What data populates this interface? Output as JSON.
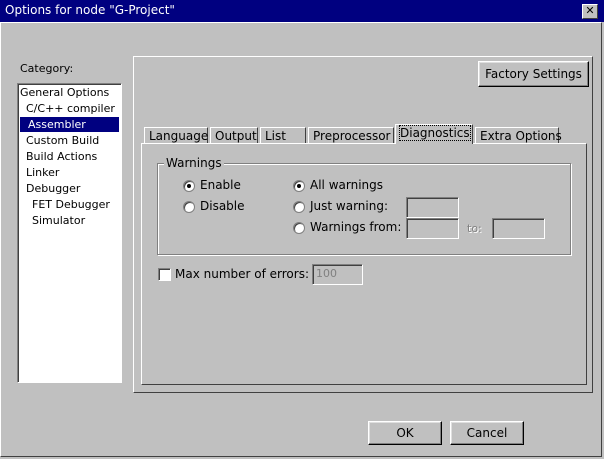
{
  "window": {
    "title": "Options for node \"G-Project\"",
    "close_glyph": "✕"
  },
  "category": {
    "label": "Category:",
    "items": [
      {
        "label": "General Options"
      },
      {
        "label": "C/C++ compiler"
      },
      {
        "label": "Assembler"
      },
      {
        "label": "Custom Build"
      },
      {
        "label": "Build Actions"
      },
      {
        "label": "Linker"
      },
      {
        "label": "Debugger"
      },
      {
        "label": "FET Debugger"
      },
      {
        "label": "Simulator"
      }
    ],
    "selected": "Assembler"
  },
  "factory_settings_label": "Factory Settings",
  "tabs": [
    {
      "label": "Language"
    },
    {
      "label": "Output"
    },
    {
      "label": "List"
    },
    {
      "label": "Preprocessor"
    },
    {
      "label": "Diagnostics"
    },
    {
      "label": "Extra Options"
    }
  ],
  "active_tab": "Diagnostics",
  "warnings": {
    "group_title": "Warnings",
    "enable_label": "Enable",
    "disable_label": "Disable",
    "enable_checked": true,
    "all_label": "All warnings",
    "just_label": "Just warning:",
    "from_label": "Warnings from:",
    "to_label": "to:",
    "all_checked": true,
    "just_value": "",
    "from_value": "",
    "to_value": ""
  },
  "max_errors": {
    "label": "Max number of errors:",
    "checked": false,
    "value": "100"
  },
  "ok_label": "OK",
  "cancel_label": "Cancel"
}
